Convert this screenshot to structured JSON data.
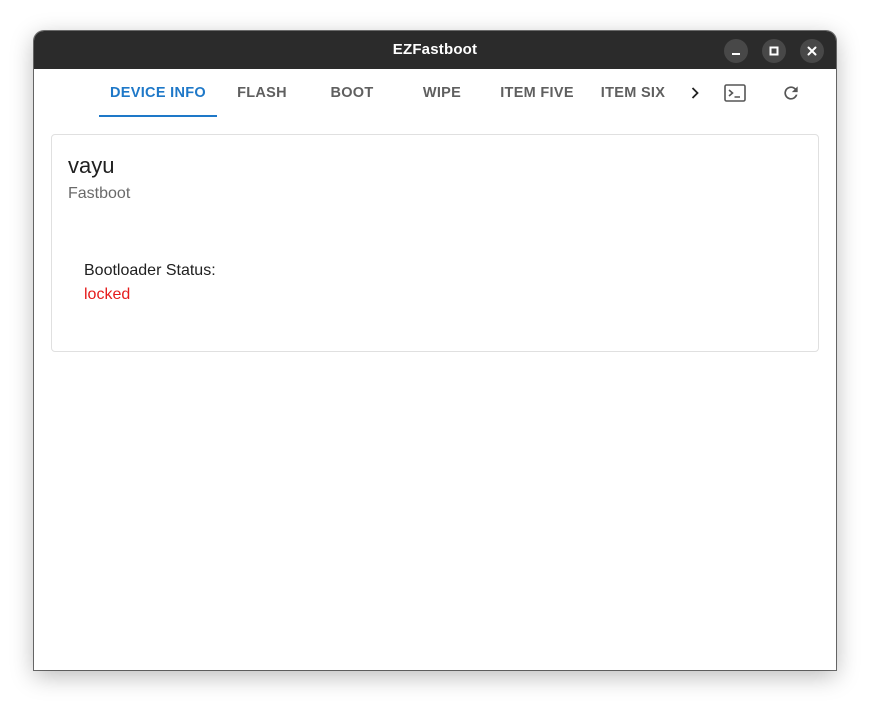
{
  "window": {
    "title": "EZFastboot"
  },
  "tabs": [
    {
      "label": "DEVICE INFO",
      "active": true
    },
    {
      "label": "FLASH",
      "active": false
    },
    {
      "label": "BOOT",
      "active": false
    },
    {
      "label": "WIPE",
      "active": false
    },
    {
      "label": "ITEM FIVE",
      "active": false
    },
    {
      "label": "ITEM SIX",
      "active": false
    }
  ],
  "toolbar": {
    "scroll_icon": "chevron-right-icon",
    "terminal_icon": "terminal-icon",
    "refresh_icon": "refresh-icon"
  },
  "device": {
    "name": "vayu",
    "mode": "Fastboot",
    "bootloader_label": "Bootloader Status:",
    "bootloader_value": "locked"
  },
  "colors": {
    "accent": "#1e78c8",
    "status_locked": "#e51b1b",
    "titlebar": "#2b2b2b"
  }
}
